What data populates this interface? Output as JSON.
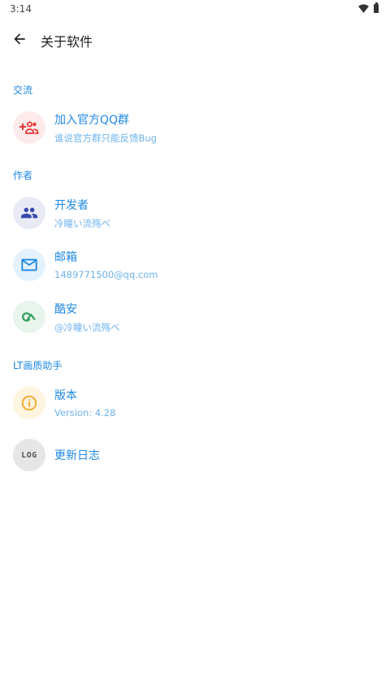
{
  "status_bar": {
    "time": "3:14"
  },
  "app_bar": {
    "title": "关于软件",
    "back_icon": "arrow-back-icon"
  },
  "sections": {
    "communication": "交流",
    "author": "作者",
    "app": "LT画质助手"
  },
  "items": {
    "qq_group": {
      "title": "加入官方QQ群",
      "subtitle": "谁说官方群只能反馈Bug",
      "icon": "group-add-icon",
      "icon_color": "#e53935",
      "bg": "#fdeaea"
    },
    "developer": {
      "title": "开发者",
      "subtitle": "冷瞳い流殇ベ",
      "icon": "people-icon",
      "icon_color": "#3949ab",
      "bg": "#e8eaf6"
    },
    "email": {
      "title": "邮箱",
      "subtitle": "1489771500@qq.com",
      "icon": "mail-icon",
      "icon_color": "#1e88e5",
      "bg": "#e3f2fd"
    },
    "coolapk": {
      "title": "酷安",
      "subtitle": "@冷瞳い流殇ベ",
      "icon": "coolapk-icon",
      "icon_color": "#2e9e5b",
      "bg": "#e8f5ec"
    },
    "version": {
      "title": "版本",
      "subtitle": "Version: 4.28",
      "icon": "info-icon",
      "icon_color": "#f5a623",
      "bg": "#fff4e0"
    },
    "changelog": {
      "title": "更新日志",
      "icon_text": "LOG",
      "icon": "log-icon",
      "icon_color": "#555555",
      "bg": "#e6e6e6"
    }
  }
}
